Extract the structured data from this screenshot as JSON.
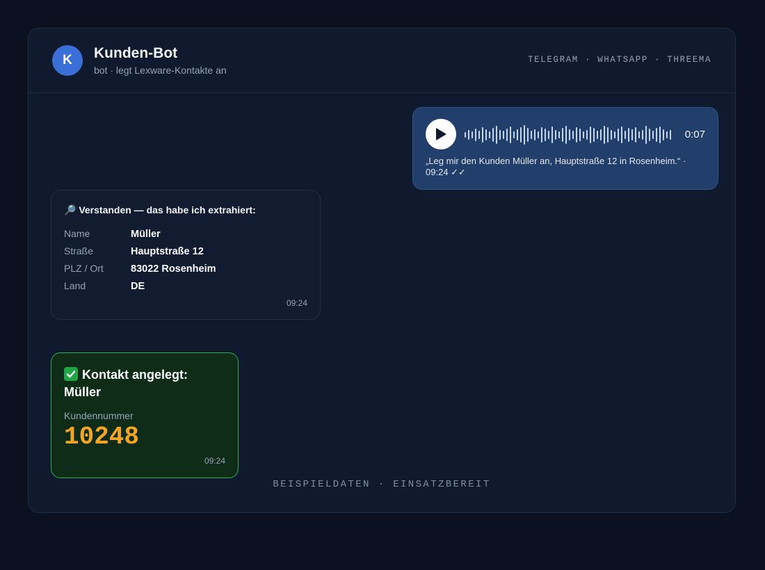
{
  "header": {
    "avatar_letter": "K",
    "title": "Kunden-Bot",
    "subtitle": "bot · legt Lexware-Kontakte an",
    "channels": "TELEGRAM · WHATSAPP · THREEMA"
  },
  "voice_message": {
    "duration": "0:07",
    "transcript": "„Leg mir den Kunden Müller an, Hauptstraße 12 in Rosenheim.“ · 09:24 ✓✓"
  },
  "extraction": {
    "title": "🔎 Verstanden — das habe ich extrahiert:",
    "fields": [
      {
        "label": "Name",
        "value": "Müller"
      },
      {
        "label": "Straße",
        "value": "Hauptstraße 12"
      },
      {
        "label": "PLZ / Ort",
        "value": "83022 Rosenheim"
      },
      {
        "label": "Land",
        "value": "DE"
      }
    ],
    "time": "09:24"
  },
  "contact_created": {
    "title": "Kontakt angelegt: Müller",
    "customer_number_label": "Kundennummer",
    "customer_number": "10248",
    "time": "09:24"
  },
  "footer": "BEISPIELDATEN · EINSATZBEREIT",
  "colors": {
    "accent": "#3b6fd8",
    "voice_bubble": "#223f6b",
    "success_border": "#2fae4e",
    "customer_number": "#f5a524"
  },
  "icons": {
    "play": "play-icon",
    "waveform": "waveform-icon",
    "success": "check-mark-icon"
  }
}
